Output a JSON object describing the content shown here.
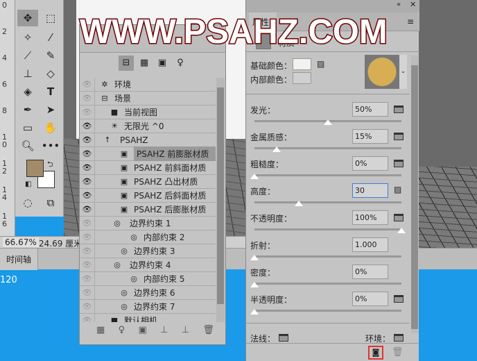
{
  "ruler": [
    "0",
    "2",
    "4",
    "6",
    "8",
    "1 0",
    "1 2",
    "1 4",
    "1 6"
  ],
  "status": {
    "zoom": "66.67%",
    "size": "24.69 厘米"
  },
  "timeline": {
    "tab": "时间轴"
  },
  "desktop": {
    "text": "120"
  },
  "colors": {
    "foreground": "#a38a69",
    "background": "#ffffff",
    "highlight": "#e33333"
  },
  "panel3d": {
    "toolbar": [
      "scene-icon",
      "mesh-icon",
      "material-icon",
      "light-icon"
    ],
    "rows": [
      {
        "label": "环境",
        "icon": "✲",
        "eye": false,
        "indent": 0
      },
      {
        "label": "场景",
        "icon": "⊟",
        "eye": false,
        "indent": 0
      },
      {
        "label": "当前视图",
        "icon": "■",
        "eye": false,
        "indent": 1
      },
      {
        "label": "无限光 ^0",
        "icon": "☀",
        "eye": true,
        "indent": 1
      },
      {
        "label": "PSAHZ",
        "icon": "⌵ ↑",
        "eye": true,
        "indent": 0
      },
      {
        "label": "PSAHZ 前膨胀材质",
        "icon": "▣",
        "eye": true,
        "indent": 2,
        "selected": true
      },
      {
        "label": "PSAHZ 前斜面材质",
        "icon": "▣",
        "eye": true,
        "indent": 2
      },
      {
        "label": "PSAHZ 凸出材质",
        "icon": "▣",
        "eye": true,
        "indent": 2
      },
      {
        "label": "PSAHZ 后斜面材质",
        "icon": "▣",
        "eye": true,
        "indent": 2
      },
      {
        "label": "PSAHZ 后膨胀材质",
        "icon": "▣",
        "eye": true,
        "indent": 2
      },
      {
        "label": "边界约束 1",
        "icon": "⌵ ◎",
        "eye": false,
        "indent": 1
      },
      {
        "label": "内部约束 2",
        "icon": "◎",
        "eye": false,
        "indent": 3
      },
      {
        "label": "边界约束 3",
        "icon": "◎",
        "eye": false,
        "indent": 2
      },
      {
        "label": "边界约束 4",
        "icon": "⌵ ◎",
        "eye": false,
        "indent": 1
      },
      {
        "label": "内部约束 5",
        "icon": "◎",
        "eye": false,
        "indent": 3
      },
      {
        "label": "边界约束 6",
        "icon": "◎",
        "eye": false,
        "indent": 2
      },
      {
        "label": "边界约束 7",
        "icon": "◎",
        "eye": false,
        "indent": 2
      },
      {
        "label": "默认相机",
        "icon": "■",
        "eye": false,
        "indent": 1
      }
    ],
    "bottom": [
      "▦",
      "♀",
      "▣",
      "⊥",
      "⊥",
      "🗑"
    ]
  },
  "props": {
    "tab": "属性",
    "subtab": "材质",
    "base_color_label": "基础颜色：",
    "inner_color_label": "内部颜色：",
    "base_color": "#f3f2ec",
    "inner_color": "#d0d0d0",
    "sliders": [
      {
        "label": "发光：",
        "value": "50%",
        "pct": 50,
        "icon": "folder"
      },
      {
        "label": "金属质感：",
        "value": "15%",
        "pct": 15,
        "icon": "folder"
      },
      {
        "label": "粗糙度：",
        "value": "0%",
        "pct": 0,
        "icon": "folder"
      },
      {
        "label": "高度：",
        "value": "30",
        "pct": 30,
        "icon": "texture",
        "focused": true
      },
      {
        "label": "不透明度：",
        "value": "100%",
        "pct": 100,
        "icon": "folder"
      },
      {
        "label": "折射：",
        "value": "1.000",
        "pct": 0,
        "icon": "none"
      },
      {
        "label": "密度：",
        "value": "0%",
        "pct": 0,
        "icon": "none"
      },
      {
        "label": "半透明度：",
        "value": "0%",
        "pct": 0,
        "icon": "folder"
      }
    ],
    "normal_label": "法线：",
    "env_label": "环境："
  },
  "watermark": "WWW.PSAHZ.COM"
}
